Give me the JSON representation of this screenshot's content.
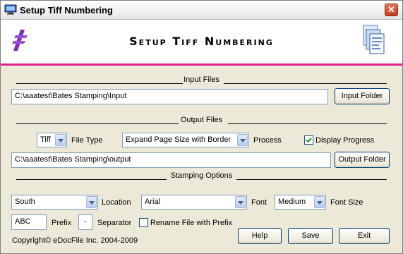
{
  "window": {
    "title": "Setup Tiff Numbering",
    "close_icon": "close-icon"
  },
  "banner": {
    "title": "Setup Tiff Numbering"
  },
  "input_section": {
    "label": "Input Files",
    "path": "C:\\aaatest\\Bates Stamping\\Input",
    "button": "Input Folder"
  },
  "output_section": {
    "label": "Output Files",
    "file_type_value": "Tiff",
    "file_type_label": "File Type",
    "process_value": "Expand Page Size with Border",
    "process_label": "Process",
    "display_progress_label": "Display Progress",
    "display_progress_checked": true,
    "path": "C:\\aaatest\\Bates Stamping\\output",
    "button": "Output Folder"
  },
  "stamping_section": {
    "label": "Stamping Options",
    "location_value": "South",
    "location_label": "Location",
    "font_value": "Arial",
    "font_label": "Font",
    "font_size_value": "Medium",
    "font_size_label": "Font Size",
    "prefix_value": "ABC",
    "prefix_label": "Prefix",
    "separator_value": "-",
    "separator_label": "Separator",
    "rename_label": "Rename File with Prefix",
    "rename_checked": false
  },
  "footer": {
    "copyright": "Copyright© eDocFile Inc. 2004-2009",
    "help": "Help",
    "save": "Save",
    "exit": "Exit"
  },
  "colors": {
    "accent": "#e0208e",
    "window_bg": "#ece9d8"
  }
}
